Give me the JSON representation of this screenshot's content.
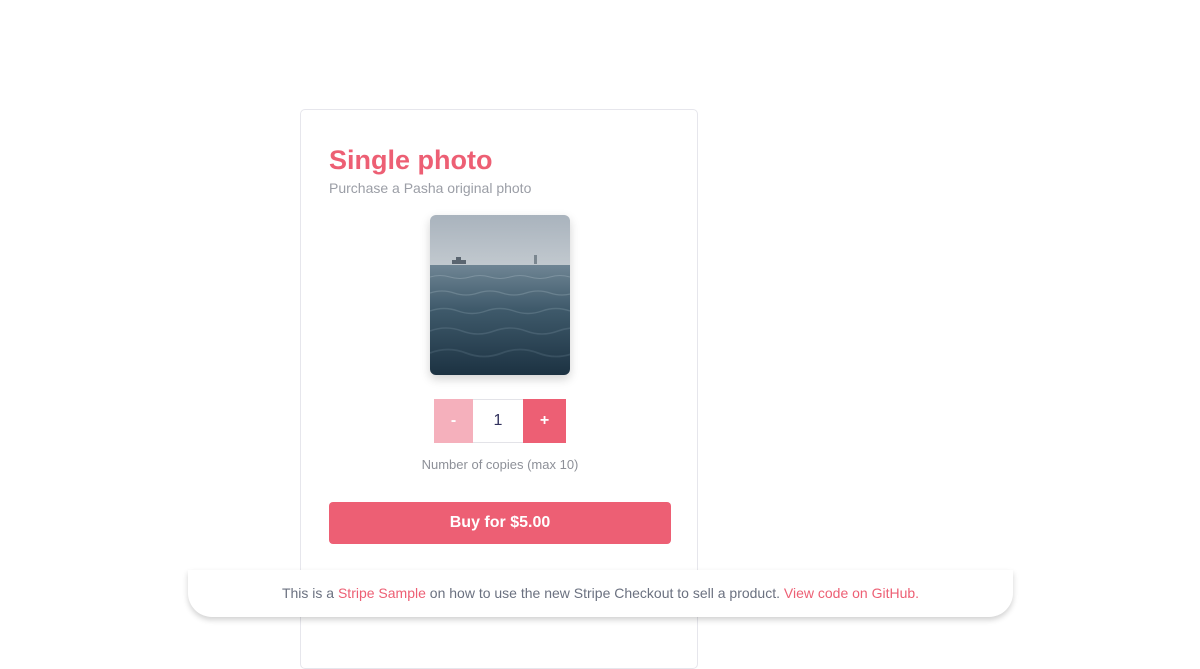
{
  "product": {
    "title": "Single photo",
    "subtitle": "Purchase a Pasha original photo"
  },
  "photo": {
    "icon": "ocean-photo"
  },
  "quantity": {
    "minus_label": "-",
    "value": "1",
    "plus_label": "+",
    "hint": "Number of copies (max 10)"
  },
  "checkout": {
    "buy_label": "Buy for $5.00"
  },
  "banner": {
    "text_prefix": "This is a ",
    "sample_link": "Stripe Sample",
    "text_middle": " on how to use the new Stripe Checkout to sell a product. ",
    "github_link": "View code on GitHub."
  },
  "colors": {
    "accent": "#ed5f74",
    "accent_light": "#f5b0bc",
    "muted_text": "#9b9ea6"
  }
}
